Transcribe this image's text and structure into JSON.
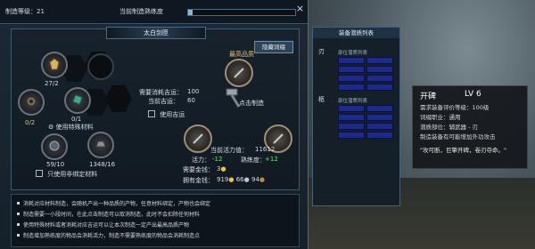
{
  "topbar": {
    "level_text": "制造等级：21",
    "proficiency_label": "当前制造熟练度",
    "proficiency_fraction": 0.04,
    "close": "×"
  },
  "craft": {
    "title": "太白剑匣",
    "hide_button": "隐藏词缀",
    "slot_counts": [
      "27/2",
      "0/1",
      "0/2",
      "59/10",
      "1348/16"
    ],
    "use_special": "使用特殊材料",
    "use_non_fixed": "只使用非绑定材料",
    "luck_need_label": "需要消耗吉运：",
    "luck_need_value": "100",
    "luck_current_label": "当前吉运：",
    "luck_current_value": "60",
    "use_luck": "使用吉运",
    "top_grade": "最高品质",
    "click_make": "点击制造",
    "vigor_label": "当前活力值：",
    "vigor_value": "11612",
    "vigor_cost_label": "活力：",
    "vigor_cost": "-12",
    "prof_label": "熟练度：",
    "prof_gain": "+12",
    "money_need_label": "需要金钱：",
    "money_need": "3",
    "money_have_label": "拥有金钱：",
    "money_have": [
      "919",
      "66",
      "94"
    ]
  },
  "notes": [
    "消耗对应材料制造，会随机产出一种品质的产物，任意材料绑定，产物也会绑定",
    "制造需要一小段时间，在此点击制造可以取消制造，此时不会扣除任何材料",
    "使用特殊材料或者消耗对应吉运可以让本次制造一定产出最高品质产物",
    "制造增加熟练度的物品会消耗活力，制造不需要熟练度的物品会消耗制造点"
  ],
  "equip": {
    "title": "装备潜质列表",
    "groups": [
      {
        "name": "刃",
        "sub": "部位潜质列表"
      },
      {
        "name": "柩",
        "sub": "部位潜质列表"
      }
    ]
  },
  "tooltip": {
    "name": "开碑",
    "level": "LV 6",
    "lines": [
      "需求装备评价等级：100级",
      "词缀职业：通用",
      "潜质部位：辅武器 - 刃",
      "制造装备有可能增加外功攻击"
    ],
    "quote": "\"攻可断，巨擎开碑，卷刃夺命。\""
  },
  "colors": {
    "accent": "#f0c24a",
    "tooltip_bg": "#14161a",
    "cell": "#1d2a8a"
  }
}
